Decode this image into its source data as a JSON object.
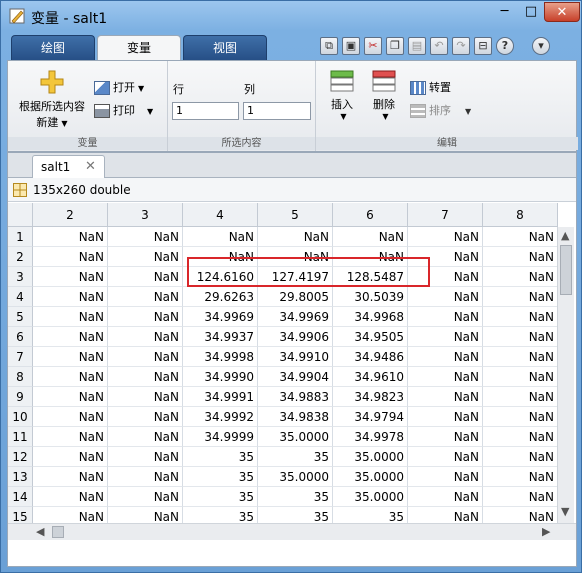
{
  "window": {
    "title": "变量 - salt1",
    "buttons": {
      "minimize": "─",
      "maximize": "□",
      "close": "✕"
    }
  },
  "ribbon": {
    "tabs": [
      "绘图",
      "变量",
      "视图"
    ],
    "active_tab": "变量",
    "variable_section": {
      "new_from_selection_line1": "根据所选内容",
      "new_from_selection_line2": "新建",
      "open": "打开",
      "print": "打印",
      "label": "变量"
    },
    "selection_section": {
      "row_label": "行",
      "col_label": "列",
      "row_value": "1",
      "col_value": "1",
      "label": "所选内容"
    },
    "edit_section": {
      "insert": "插入",
      "delete": "删除",
      "transpose": "转置",
      "sort": "排序",
      "label": "编辑"
    }
  },
  "document": {
    "tab_name": "salt1",
    "close_glyph": "✕",
    "info": "135x260 double"
  },
  "grid": {
    "columns": [
      "2",
      "3",
      "4",
      "5",
      "6",
      "7",
      "8"
    ],
    "rows": [
      {
        "n": "1",
        "cells": [
          "NaN",
          "NaN",
          "NaN",
          "NaN",
          "NaN",
          "NaN",
          "NaN"
        ]
      },
      {
        "n": "2",
        "cells": [
          "NaN",
          "NaN",
          "NaN",
          "NaN",
          "NaN",
          "NaN",
          "NaN"
        ]
      },
      {
        "n": "3",
        "cells": [
          "NaN",
          "NaN",
          "124.6160",
          "127.4197",
          "128.5487",
          "NaN",
          "NaN"
        ]
      },
      {
        "n": "4",
        "cells": [
          "NaN",
          "NaN",
          "29.6263",
          "29.8005",
          "30.5039",
          "NaN",
          "NaN"
        ]
      },
      {
        "n": "5",
        "cells": [
          "NaN",
          "NaN",
          "34.9969",
          "34.9969",
          "34.9968",
          "NaN",
          "NaN"
        ]
      },
      {
        "n": "6",
        "cells": [
          "NaN",
          "NaN",
          "34.9937",
          "34.9906",
          "34.9505",
          "NaN",
          "NaN"
        ]
      },
      {
        "n": "7",
        "cells": [
          "NaN",
          "NaN",
          "34.9998",
          "34.9910",
          "34.9486",
          "NaN",
          "NaN"
        ]
      },
      {
        "n": "8",
        "cells": [
          "NaN",
          "NaN",
          "34.9990",
          "34.9904",
          "34.9610",
          "NaN",
          "NaN"
        ]
      },
      {
        "n": "9",
        "cells": [
          "NaN",
          "NaN",
          "34.9991",
          "34.9883",
          "34.9823",
          "NaN",
          "NaN"
        ]
      },
      {
        "n": "10",
        "cells": [
          "NaN",
          "NaN",
          "34.9992",
          "34.9838",
          "34.9794",
          "NaN",
          "NaN"
        ]
      },
      {
        "n": "11",
        "cells": [
          "NaN",
          "NaN",
          "34.9999",
          "35.0000",
          "34.9978",
          "NaN",
          "NaN"
        ]
      },
      {
        "n": "12",
        "cells": [
          "NaN",
          "NaN",
          "35",
          "35",
          "35.0000",
          "NaN",
          "NaN"
        ]
      },
      {
        "n": "13",
        "cells": [
          "NaN",
          "NaN",
          "35",
          "35.0000",
          "35.0000",
          "NaN",
          "NaN"
        ]
      },
      {
        "n": "14",
        "cells": [
          "NaN",
          "NaN",
          "35",
          "35",
          "35.0000",
          "NaN",
          "NaN"
        ]
      },
      {
        "n": "15",
        "cells": [
          "NaN",
          "NaN",
          "35",
          "35",
          "35",
          "NaN",
          "NaN"
        ]
      }
    ]
  },
  "highlight_color": "#d9262a"
}
